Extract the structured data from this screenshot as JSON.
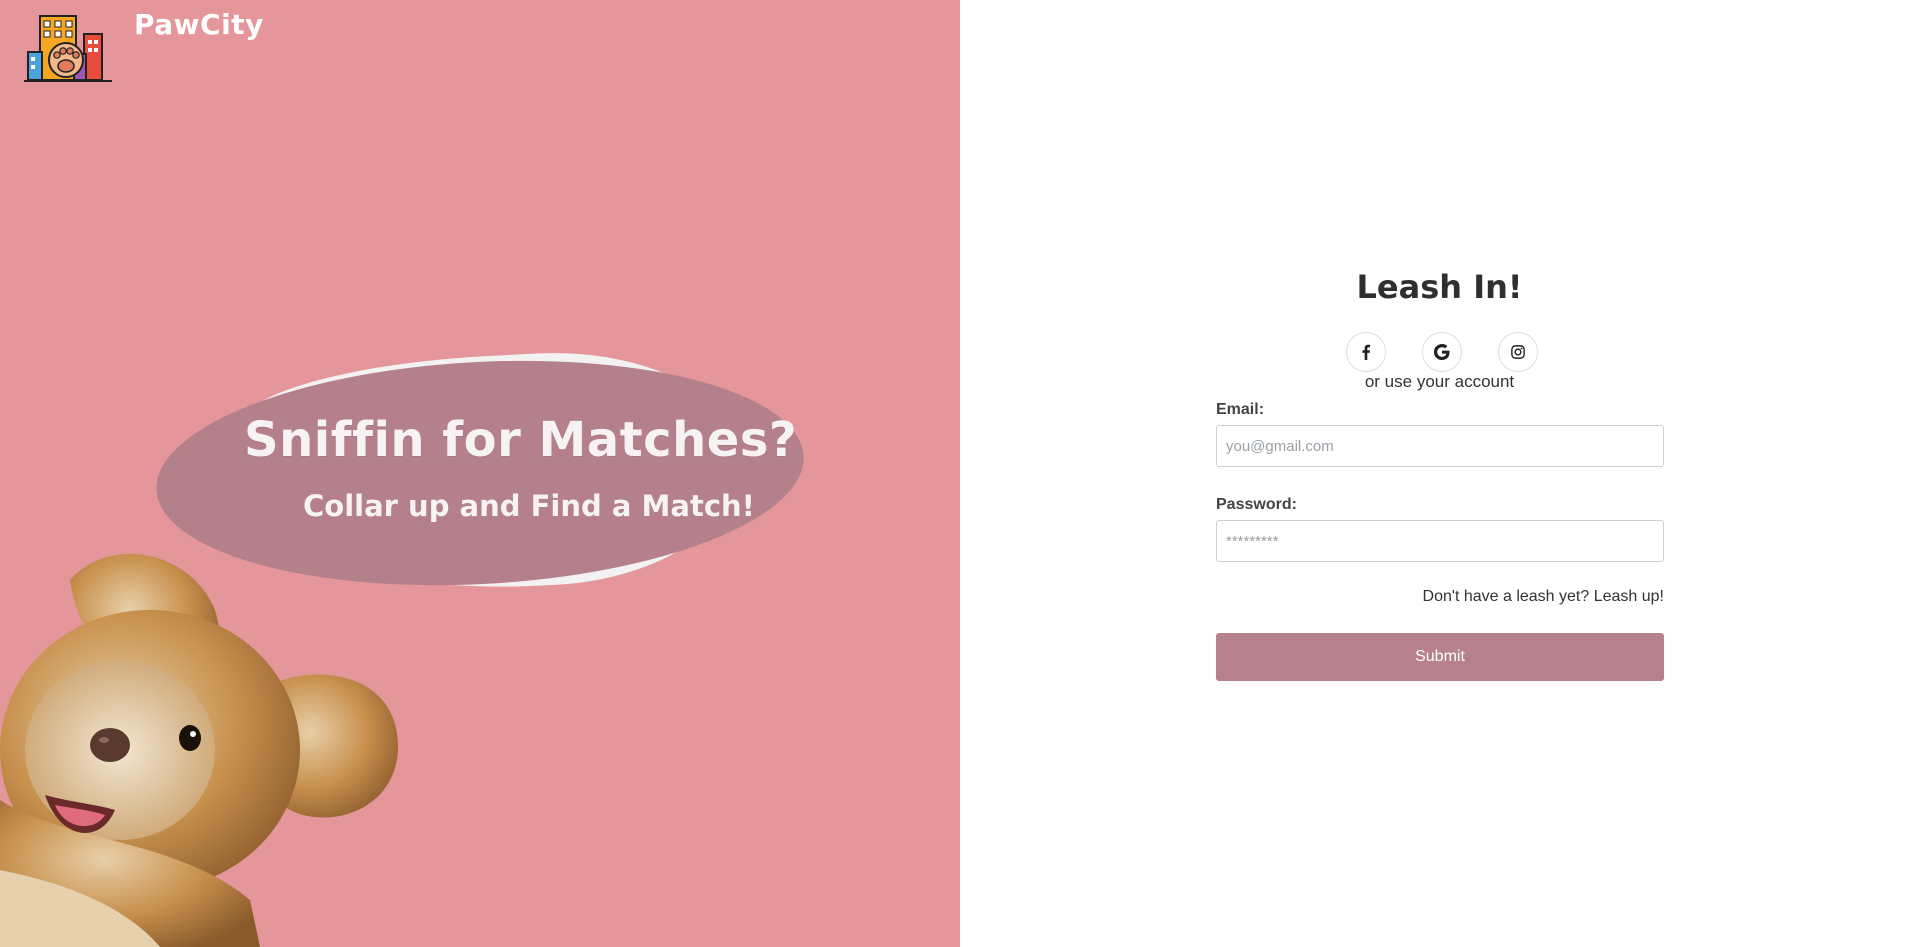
{
  "brand": {
    "name": "PawCity",
    "logo_icon": "city-paw-logo-icon"
  },
  "hero": {
    "headline": "Sniffin for Matches?",
    "subline": "Collar up and Find a Match!",
    "image": "dog-photo"
  },
  "form": {
    "title": "Leash In!",
    "socials": [
      {
        "name": "facebook",
        "icon": "facebook-icon"
      },
      {
        "name": "google",
        "icon": "google-icon"
      },
      {
        "name": "instagram",
        "icon": "instagram-icon"
      }
    ],
    "alt_text": "or use your account",
    "email": {
      "label": "Email:",
      "placeholder": "you@gmail.com",
      "value": ""
    },
    "password": {
      "label": "Password:",
      "placeholder": "*********",
      "value": ""
    },
    "signup_link": "Don't have a leash yet? Leash up!",
    "submit_label": "Submit"
  },
  "colors": {
    "left_panel_bg": "#e4969a",
    "bubble": "#b3808b",
    "submit_bg": "#b7818b",
    "text_dark": "#2f2f2f"
  }
}
